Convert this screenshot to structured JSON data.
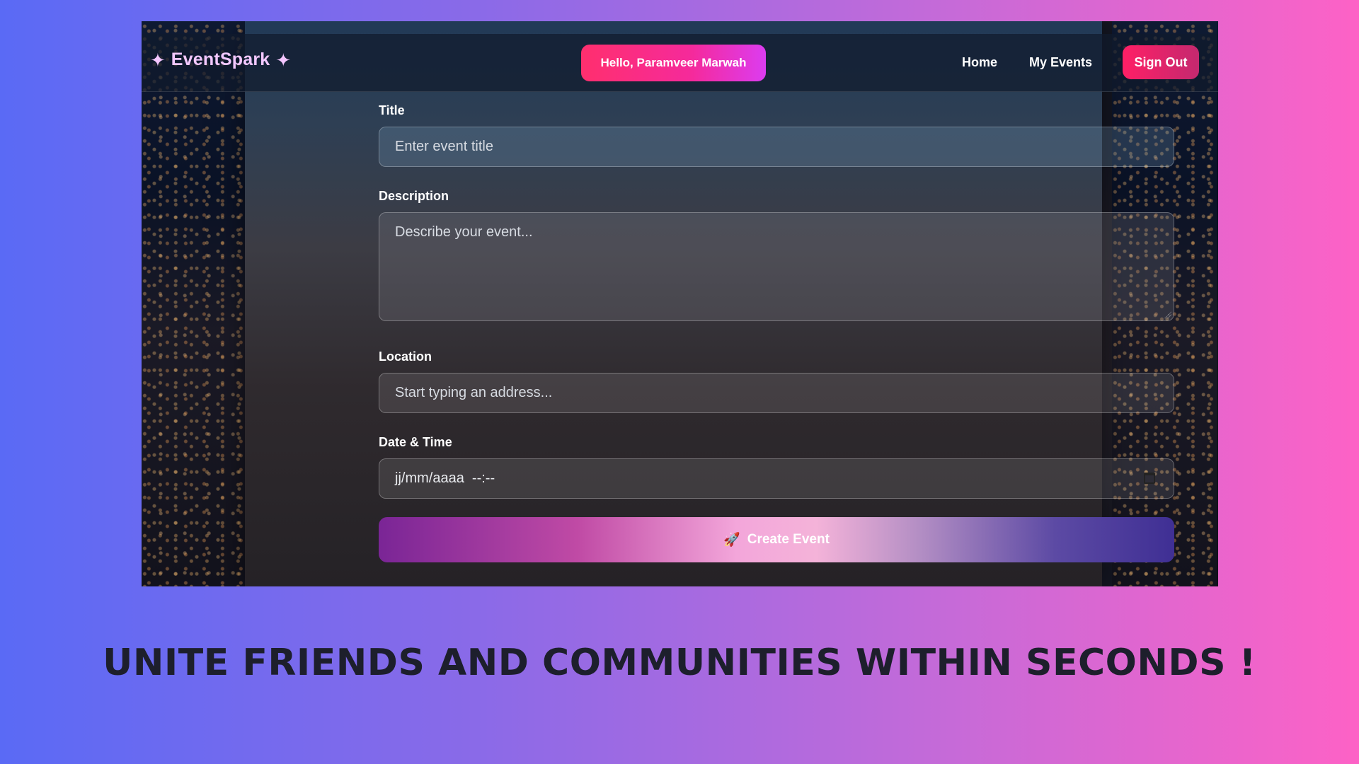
{
  "navbar": {
    "brand": "EventSpark",
    "sparkle_icon": "sparkle-icon",
    "greeting": "Hello, Paramveer Marwah",
    "links": [
      {
        "label": "Home"
      },
      {
        "label": "My Events"
      }
    ],
    "sign_out": "Sign Out"
  },
  "form": {
    "title_label": "Title",
    "title_placeholder": "Enter event title",
    "description_label": "Description",
    "description_placeholder": "Describe your event...",
    "location_label": "Location",
    "location_placeholder": "Start typing an address...",
    "datetime_label": "Date & Time",
    "datetime_value": "jj/mm/aaaa  --:--",
    "submit_label": "Create Event",
    "submit_icon": "rocket-icon"
  },
  "tagline": "UNITE FRIENDS AND COMMUNITIES WITHIN SECONDS !",
  "colors": {
    "accent_pink": "#ff2f6e",
    "accent_purple": "#dc3cf0",
    "background_left": "#5a6af5",
    "background_right": "#fd62c6"
  }
}
